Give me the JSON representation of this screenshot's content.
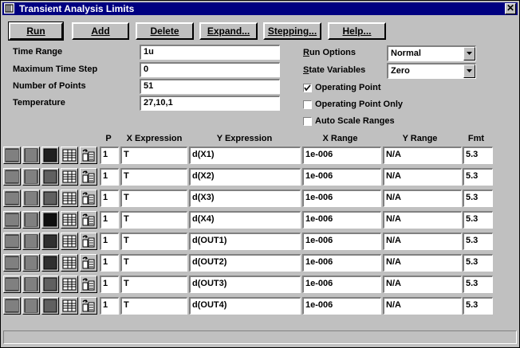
{
  "window": {
    "title": "Transient Analysis Limits",
    "close_glyph": "✕"
  },
  "toolbar": [
    {
      "label": "Run",
      "mnemonic_index": 0
    },
    {
      "label": "Add",
      "mnemonic_index": 0
    },
    {
      "label": "Delete",
      "mnemonic_index": 0
    },
    {
      "label": "Expand...",
      "mnemonic_index": 0
    },
    {
      "label": "Stepping...",
      "mnemonic_index": 0
    },
    {
      "label": "Help...",
      "mnemonic_index": 0
    }
  ],
  "fields": {
    "time_range": {
      "label": "Time Range",
      "value": "1u"
    },
    "max_time_step": {
      "label": "Maximum Time Step",
      "value": "0"
    },
    "num_points": {
      "label": "Number of Points",
      "value": "51"
    },
    "temperature": {
      "label": "Temperature",
      "value": "27,10,1"
    }
  },
  "options": {
    "run_options": {
      "label": "Run Options",
      "value": "Normal"
    },
    "state_variables": {
      "label": "State Variables",
      "value": "Zero"
    },
    "operating_point": {
      "label": "Operating Point",
      "checked": true
    },
    "operating_point_only": {
      "label": "Operating Point Only",
      "checked": false
    },
    "auto_scale_ranges": {
      "label": "Auto Scale Ranges",
      "checked": false
    }
  },
  "columns": [
    "P",
    "X Expression",
    "Y Expression",
    "X Range",
    "Y Range",
    "Fmt"
  ],
  "rows": [
    {
      "p": "1",
      "x": "T",
      "y": "d(X1)",
      "xr": "1e-006",
      "yr": "N/A",
      "fmt": "5.3",
      "color": "#202020"
    },
    {
      "p": "1",
      "x": "T",
      "y": "d(X2)",
      "xr": "1e-006",
      "yr": "N/A",
      "fmt": "5.3",
      "color": "#606060"
    },
    {
      "p": "1",
      "x": "T",
      "y": "d(X3)",
      "xr": "1e-006",
      "yr": "N/A",
      "fmt": "5.3",
      "color": "#606060"
    },
    {
      "p": "1",
      "x": "T",
      "y": "d(X4)",
      "xr": "1e-006",
      "yr": "N/A",
      "fmt": "5.3",
      "color": "#101010"
    },
    {
      "p": "1",
      "x": "T",
      "y": "d(OUT1)",
      "xr": "1e-006",
      "yr": "N/A",
      "fmt": "5.3",
      "color": "#303030"
    },
    {
      "p": "1",
      "x": "T",
      "y": "d(OUT2)",
      "xr": "1e-006",
      "yr": "N/A",
      "fmt": "5.3",
      "color": "#303030"
    },
    {
      "p": "1",
      "x": "T",
      "y": "d(OUT3)",
      "xr": "1e-006",
      "yr": "N/A",
      "fmt": "5.3",
      "color": "#606060"
    },
    {
      "p": "1",
      "x": "T",
      "y": "d(OUT4)",
      "xr": "1e-006",
      "yr": "N/A",
      "fmt": "5.3",
      "color": "#606060"
    }
  ],
  "row_icons": [
    "vertical-grid-icon",
    "horizontal-grid-icon",
    "color-swatch-icon",
    "table-icon",
    "copy-icon"
  ],
  "status": ""
}
